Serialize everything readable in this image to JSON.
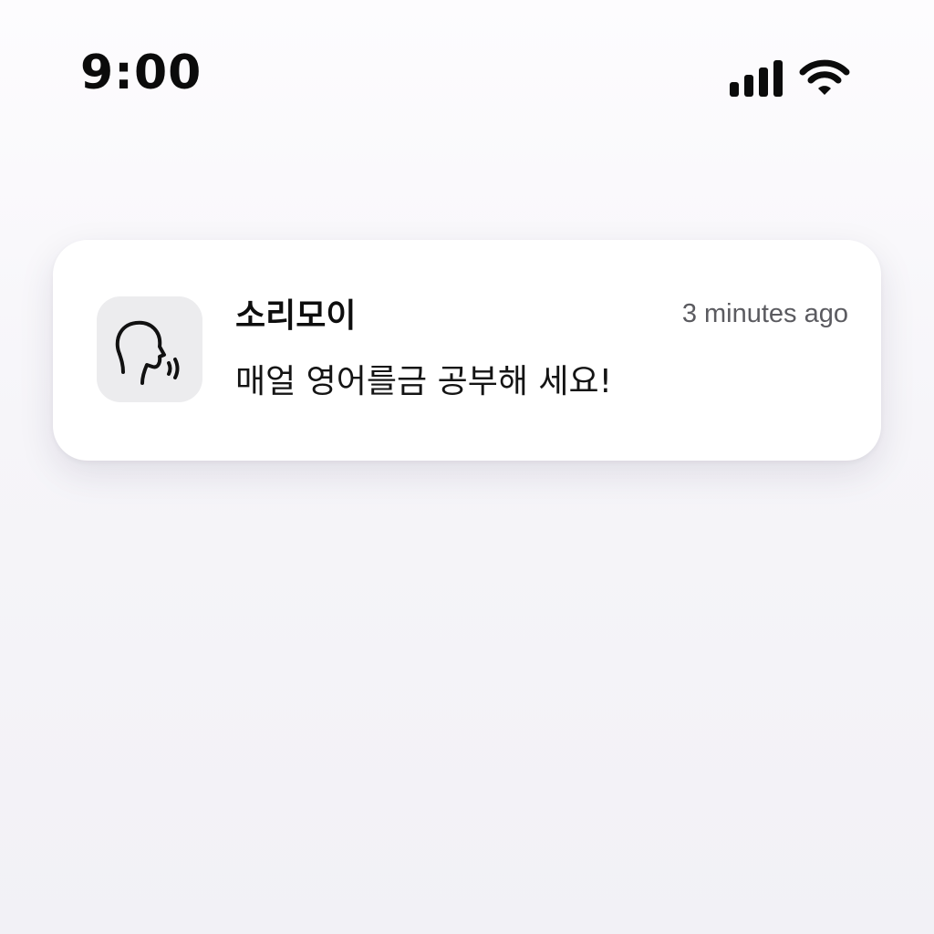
{
  "status_bar": {
    "time": "9:00",
    "signal_icon": "cellular-signal-icon",
    "wifi_icon": "wifi-icon"
  },
  "notification": {
    "app_icon": "speaking-head-icon",
    "app_name": "소리모이",
    "timestamp": "3 minutes ago",
    "message": "매얼 영어를금 공부해 세요!"
  },
  "colors": {
    "background": "#f6f5f9",
    "card": "#ffffff",
    "icon_bg": "#ececee",
    "timestamp": "#5b5b60"
  }
}
